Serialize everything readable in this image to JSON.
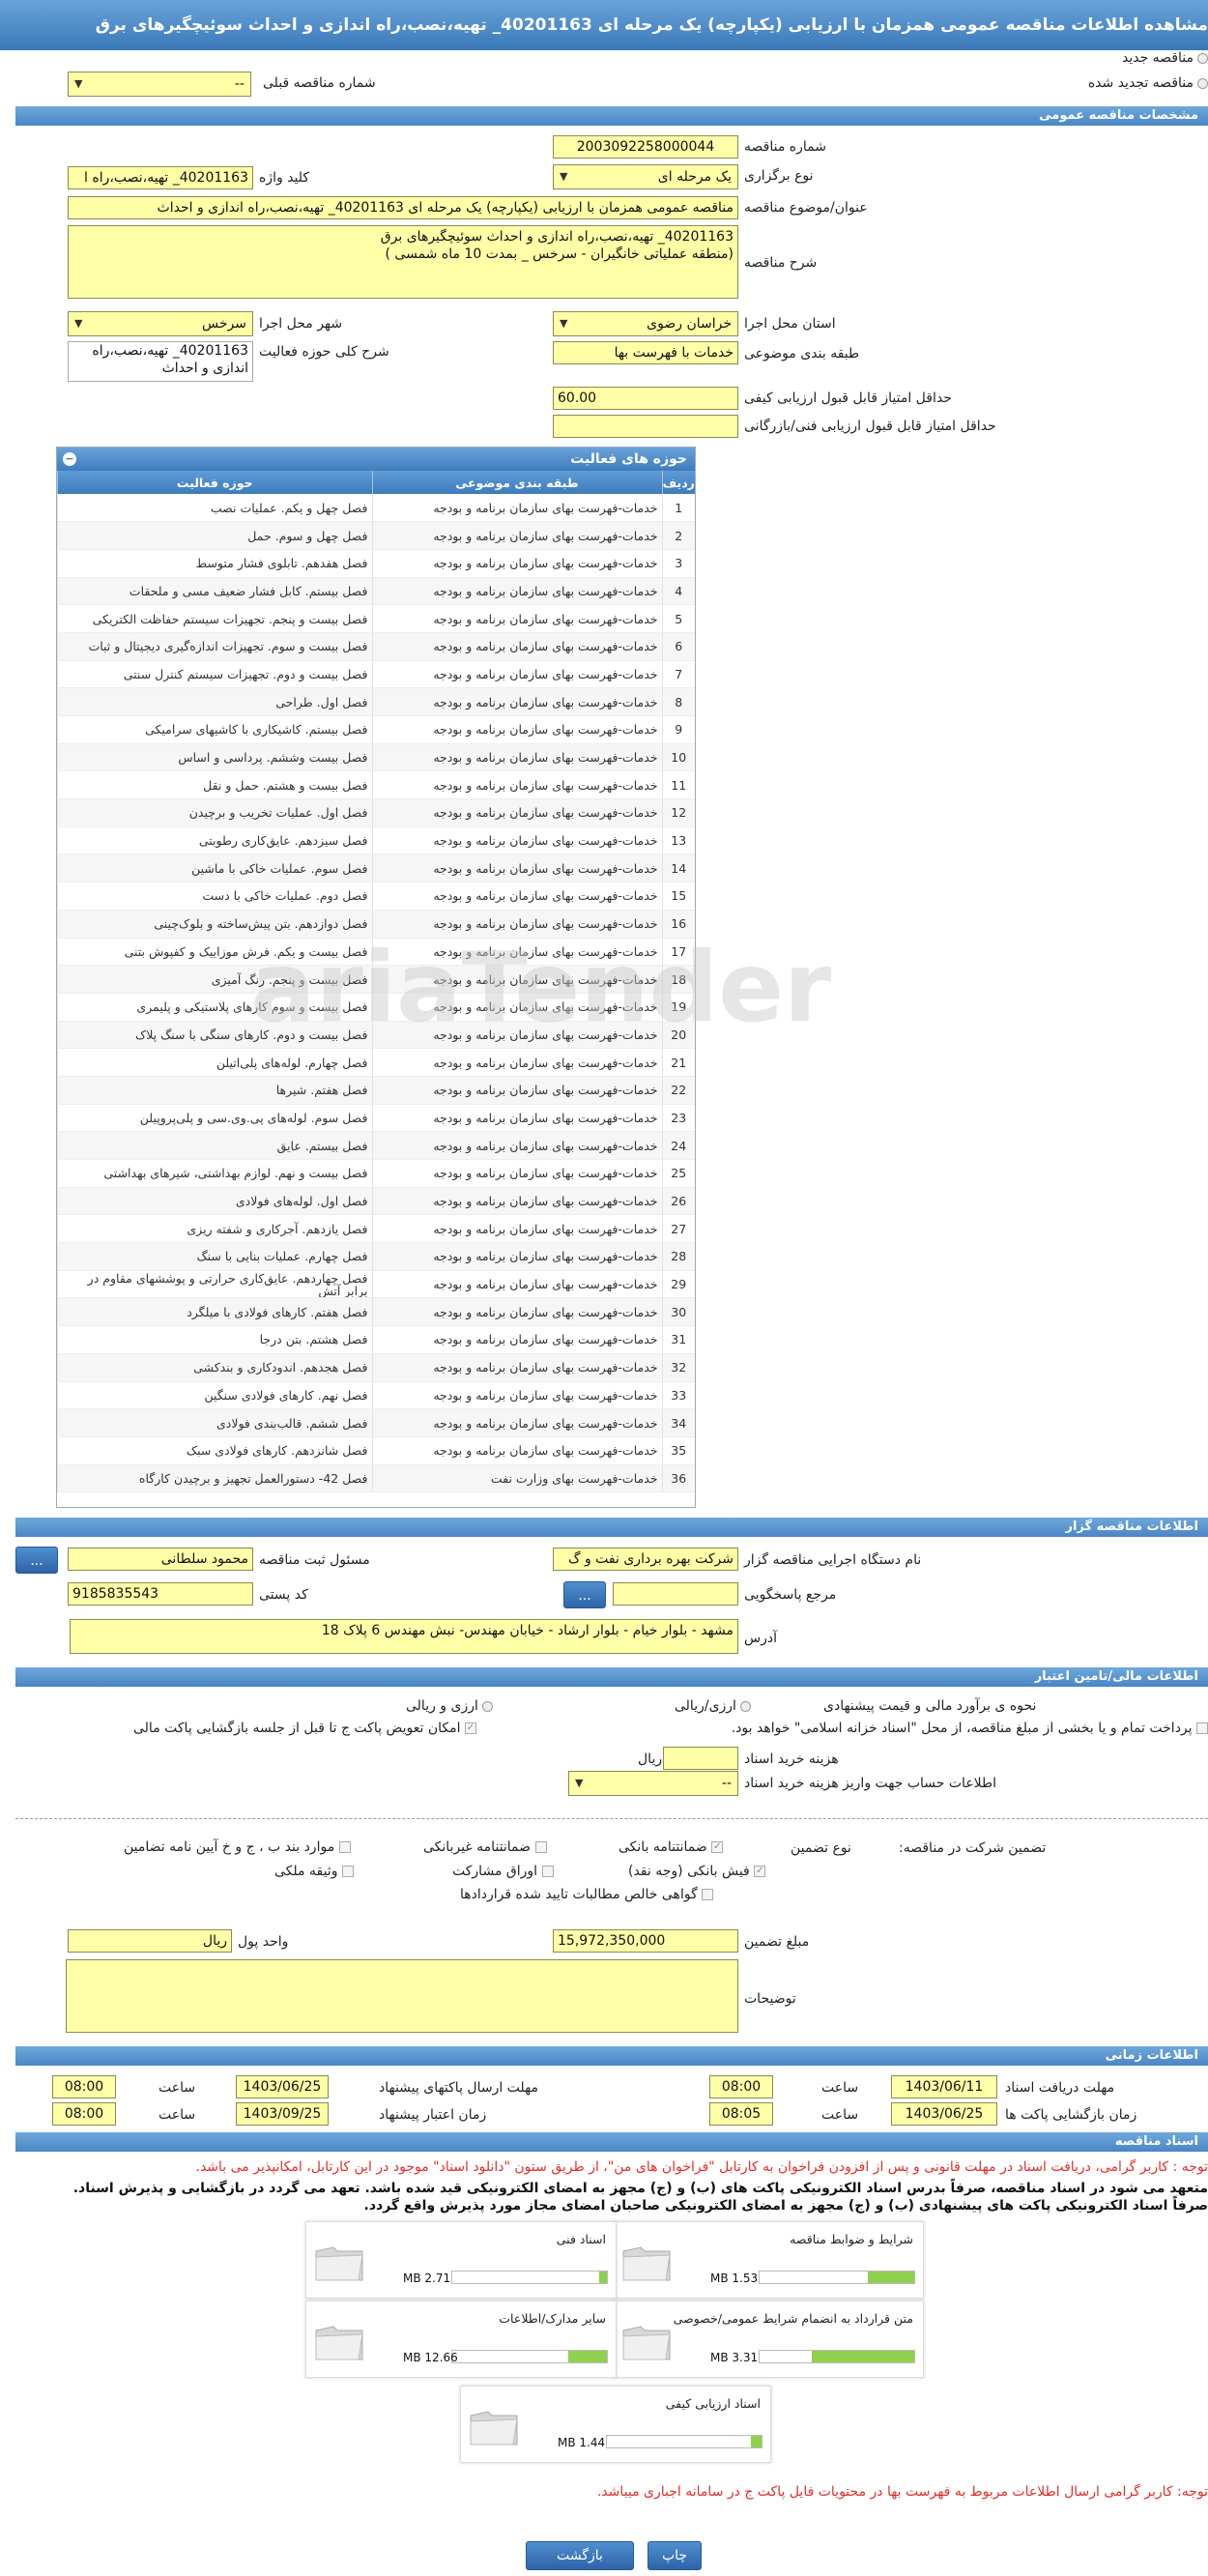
{
  "title": "مشاهده اطلاعات مناقصه عمومی همزمان با ارزیابی (یکپارچه) یک مرحله ای 40201163_ تهیه،نصب،راه اندازی و احداث سوئیچگیرهای برق",
  "top": {
    "new_tender": "مناقصه جدید",
    "renewed_tender": "مناقصه تجدید شده",
    "prev_tender_label": "شماره مناقصه قبلی",
    "prev_tender_value": "--"
  },
  "sections": {
    "general": "مشخصات مناقصه عمومی",
    "organizer": "اطلاعات مناقصه گزار",
    "financial": "اطلاعات مالی/تامین اعتبار",
    "timing": "اطلاعات زمانی",
    "documents": "اسناد مناقصه"
  },
  "general": {
    "number_label": "شماره مناقصه",
    "number": "2003092258000044",
    "method_label": "نوع برگزاری",
    "method": "یک مرحله ای",
    "keyword_label": "کلید واژه",
    "keyword": "40201163_ تهیه،نصب،راه ا",
    "subject_label": "عنوان/موضوع مناقصه",
    "subject": "مناقصه عمومی همزمان با ارزیابی (یکپارچه) یک مرحله ای 40201163_ تهیه،نصب،راه اندازی و احداث",
    "desc_label": "شرح مناقصه",
    "desc_line1": "40201163_ تهیه،نصب،راه اندازی و احداث سوئیچگیرهای برق",
    "desc_line2": "(منطقه عملیاتی خانگیران - سرخس _ بمدت 10 ماه شمسی )",
    "province_label": "استان محل اجرا",
    "province": "خراسان رضوی",
    "city_label": "شهر محل اجرا",
    "city": "سرخس",
    "category_label": "طبقه بندی موضوعی",
    "category": "خدمات با فهرست بها",
    "scope_label": "شرح کلی حوزه فعالیت",
    "scope_line1": "40201163_ تهیه،نصب،راه",
    "scope_line2": "اندازی و احداث",
    "min_quality_label": "حداقل امتیاز قابل قبول ارزیابی کیفی",
    "min_quality": "60.00",
    "min_tech_label": "حداقل امتیاز قابل قبول ارزیابی فنی/بازرگانی",
    "min_tech": ""
  },
  "activities": {
    "title": "حوزه های فعالیت",
    "col_row": "ردیف",
    "col_category": "طبقه بندی موضوعی",
    "col_field": "حوزه فعالیت",
    "rows": [
      {
        "n": "1",
        "c": "خدمات-فهرست بهای سازمان برنامه و بودجه",
        "f": "فصل چهل و یکم. عملیات نصب"
      },
      {
        "n": "2",
        "c": "خدمات-فهرست بهای سازمان برنامه و بودجه",
        "f": "فصل چهل و سوم. حمل"
      },
      {
        "n": "3",
        "c": "خدمات-فهرست بهای سازمان برنامه و بودجه",
        "f": "فصل هفدهم. تابلوی فشار متوسط"
      },
      {
        "n": "4",
        "c": "خدمات-فهرست بهای سازمان برنامه و بودجه",
        "f": "فصل بیستم. کابل فشار ضعیف مسی و ملحقات"
      },
      {
        "n": "5",
        "c": "خدمات-فهرست بهای سازمان برنامه و بودجه",
        "f": "فصل بیست و پنجم. تجهیزات سیستم حفاظت الکتریکی"
      },
      {
        "n": "6",
        "c": "خدمات-فهرست بهای سازمان برنامه و بودجه",
        "f": "فصل بیست و سوم. تجهیزات اندازه‌گیری دیجیتال و ثبات"
      },
      {
        "n": "7",
        "c": "خدمات-فهرست بهای سازمان برنامه و بودجه",
        "f": "فصل بیست و دوم. تجهیزات سیستم کنترل سنتی"
      },
      {
        "n": "8",
        "c": "خدمات-فهرست بهای سازمان برنامه و بودجه",
        "f": "فصل اول. طراحی"
      },
      {
        "n": "9",
        "c": "خدمات-فهرست بهای سازمان برنامه و بودجه",
        "f": "فصل بیستم. کاشیکاری با کاشیهای سرامیکی"
      },
      {
        "n": "10",
        "c": "خدمات-فهرست بهای سازمان برنامه و بودجه",
        "f": "فصل بیست وششم. پرداسی و اساس"
      },
      {
        "n": "11",
        "c": "خدمات-فهرست بهای سازمان برنامه و بودجه",
        "f": "فصل بیست و هشتم. حمل و نقل"
      },
      {
        "n": "12",
        "c": "خدمات-فهرست بهای سازمان برنامه و بودجه",
        "f": "فصل اول. عملیات تخریب و برچیدن"
      },
      {
        "n": "13",
        "c": "خدمات-فهرست بهای سازمان برنامه و بودجه",
        "f": "فصل سیزدهم. عایق‌کاری رطوبتی"
      },
      {
        "n": "14",
        "c": "خدمات-فهرست بهای سازمان برنامه و بودجه",
        "f": "فصل سوم. عملیات خاکی با ماشین"
      },
      {
        "n": "15",
        "c": "خدمات-فهرست بهای سازمان برنامه و بودجه",
        "f": "فصل دوم. عملیات خاکی با دست"
      },
      {
        "n": "16",
        "c": "خدمات-فهرست بهای سازمان برنامه و بودجه",
        "f": "فصل دوازدهم. بتن پیش‌ساخته و بلوک‌چینی"
      },
      {
        "n": "17",
        "c": "خدمات-فهرست بهای سازمان برنامه و بودجه",
        "f": "فصل بیست و یکم. فرش موزاییک و کفپوش بتنی"
      },
      {
        "n": "18",
        "c": "خدمات-فهرست بهای سازمان برنامه و بودجه",
        "f": "فصل بیست و پنجم. رنگ آمیزی"
      },
      {
        "n": "19",
        "c": "خدمات-فهرست بهای سازمان برنامه و بودجه",
        "f": "فصل بیست و سوم کارهای پلاستیکی و پلیمری"
      },
      {
        "n": "20",
        "c": "خدمات-فهرست بهای سازمان برنامه و بودجه",
        "f": "فصل بیست و دوم. کارهای سنگی با سنگ پلاک"
      },
      {
        "n": "21",
        "c": "خدمات-فهرست بهای سازمان برنامه و بودجه",
        "f": "فصل چهارم. لوله‌های پلی‌اتیلن"
      },
      {
        "n": "22",
        "c": "خدمات-فهرست بهای سازمان برنامه و بودجه",
        "f": "فصل هفتم. شیرها"
      },
      {
        "n": "23",
        "c": "خدمات-فهرست بهای سازمان برنامه و بودجه",
        "f": "فصل سوم. لوله‌های پی.وی.سی و پلی‌پروپیلن"
      },
      {
        "n": "24",
        "c": "خدمات-فهرست بهای سازمان برنامه و بودجه",
        "f": "فصل بیستم. عایق"
      },
      {
        "n": "25",
        "c": "خدمات-فهرست بهای سازمان برنامه و بودجه",
        "f": "فصل بیست و نهم. لوازم بهداشتی، شیرهای بهداشتی"
      },
      {
        "n": "26",
        "c": "خدمات-فهرست بهای سازمان برنامه و بودجه",
        "f": "فصل اول. لوله‌های فولادی"
      },
      {
        "n": "27",
        "c": "خدمات-فهرست بهای سازمان برنامه و بودجه",
        "f": "فصل یازدهم. آجرکاری و شفته ریزی"
      },
      {
        "n": "28",
        "c": "خدمات-فهرست بهای سازمان برنامه و بودجه",
        "f": "فصل چهارم. عملیات بنایی با سنگ"
      },
      {
        "n": "29",
        "c": "خدمات-فهرست بهای سازمان برنامه و بودجه",
        "f": "فصل چهاردهم. عایق‌کاری حرارتی و پوششهای مقاوم در برابر آتش"
      },
      {
        "n": "30",
        "c": "خدمات-فهرست بهای سازمان برنامه و بودجه",
        "f": "فصل هفتم. کارهای فولادی با میلگرد"
      },
      {
        "n": "31",
        "c": "خدمات-فهرست بهای سازمان برنامه و بودجه",
        "f": "فصل هشتم. بتن درجا"
      },
      {
        "n": "32",
        "c": "خدمات-فهرست بهای سازمان برنامه و بودجه",
        "f": "فصل هجدهم. اندودکاری و بندکشی"
      },
      {
        "n": "33",
        "c": "خدمات-فهرست بهای سازمان برنامه و بودجه",
        "f": "فصل نهم. کارهای فولادی سنگین"
      },
      {
        "n": "34",
        "c": "خدمات-فهرست بهای سازمان برنامه و بودجه",
        "f": "فصل ششم. قالب‌بندی فولادی"
      },
      {
        "n": "35",
        "c": "خدمات-فهرست بهای سازمان برنامه و بودجه",
        "f": "فصل شانزدهم. کارهای فولادی سبک"
      },
      {
        "n": "36",
        "c": "خدمات-فهرست بهای وزارت نفت",
        "f": "فصل 42- دستورالعمل تجهیز و برچیدن کارگاه"
      }
    ]
  },
  "organizer": {
    "device_label": "نام دستگاه اجرایی مناقصه گزار",
    "device": "شرکت بهره برداری نفت و گ",
    "registrar_label": "مسئول ثبت مناقصه",
    "registrar": "محمود سلطانی",
    "registrar_btn": "...",
    "ref_label": "مرجع پاسخگویی",
    "ref": "",
    "ref_btn": "...",
    "postal_label": "کد پستی",
    "postal": "9185835543",
    "address_label": "آدرس",
    "address": "مشهد - بلوار خیام - بلوار ارشاد - خیابان مهندس- نبش مهندس 6 پلاک 18"
  },
  "financial": {
    "estimate_label": "نحوه ی برآورد مالی و قیمت پیشنهادی",
    "opt_rial_fx": "ارزی/ریالی",
    "opt_fx_rial": "ارزی و ریالی",
    "swap_label": "امکان تعویض پاکت ج تا قبل از جلسه بازگشایی پاکت مالی",
    "payment_label": "پرداخت تمام و یا بخشی از مبلغ مناقصه، از محل \"اسناد خزانه اسلامی\" خواهد بود.",
    "doc_fee_label": "هزینه خرید اسناد",
    "doc_fee": "",
    "doc_fee_unit": "ریال",
    "account_label": "اطلاعات حساب جهت واریز هزینه خرید اسناد",
    "account": "--",
    "guarantee_label": "تضمین شرکت در مناقصه:",
    "guarantee_type_label": "نوع تضمین",
    "g_bank": "ضمانتنامه بانکی",
    "g_nonbank": "ضمانتنامه غیربانکی",
    "g_clauses": "موارد بند ب ، ج و خ آیین نامه تضامین",
    "g_cheque": "فیش بانکی (وجه نقد)",
    "g_bonds": "اوراق مشارکت",
    "g_property": "وثیقه ملکی",
    "g_claims": "گواهی خالص مطالبات تایید شده قراردادها",
    "amount_label": "مبلغ تضمین",
    "amount": "15,972,350,000",
    "currency_label": "واحد پول",
    "currency": "ریال",
    "notes_label": "توضیحات",
    "notes": ""
  },
  "timing": {
    "doc_receive_label": "مهلت دریافت اسناد",
    "doc_receive_date": "1403/06/11",
    "doc_receive_time": "08:00",
    "submit_label": "مهلت ارسال پاکتهای پیشنهاد",
    "submit_date": "1403/06/25",
    "submit_time": "08:00",
    "open_label": "زمان بازگشایی پاکت ها",
    "open_date": "1403/06/25",
    "open_time": "08:05",
    "validity_label": "زمان اعتبار پیشنهاد",
    "validity_date": "1403/09/25",
    "validity_time": "08:00",
    "time_label": "ساعت"
  },
  "documents": {
    "note1": "توجه : کاربر گرامی، دریافت اسناد در مهلت قانونی و پس از افزودن فراخوان به کارتابل \"فراخوان های من\"، از طریق ستون \"دانلود اسناد\" موجود در این کارتابل، امکانپذیر می باشد.",
    "note2": "متعهد می شود در اسناد مناقصه، صرفاً بدرس اسناد الکترونیکی پاکت های (ب) و (ج) مجهز به امضای الکترونیکی قید شده باشد. تعهد می گردد در بازگشایی و پذیرش اسناد.",
    "note3": "صرفاً اسناد الکترونیکی پاکت های پیشنهادی (ب) و (ج) مجهز به امضای الکترونیکی صاحبان امضای مجاز مورد پذیرش واقع گردد.",
    "files": [
      {
        "title": "شرایط و ضوابط مناقصه",
        "size": "1.53 MB",
        "max": "5 MB",
        "pct": 0.3
      },
      {
        "title": "اسناد فنی",
        "size": "2.71 MB",
        "max": "50 MB",
        "pct": 0.05
      },
      {
        "title": "متن قرارداد به انضمام شرایط عمومی/خصوصی",
        "size": "3.31 MB",
        "max": "5 MB",
        "pct": 0.66
      },
      {
        "title": "سایر مدارک/اطلاعات",
        "size": "12.66 MB",
        "max": "50 MB",
        "pct": 0.25
      },
      {
        "title": "اسناد ارزیابی کیفی",
        "size": "1.44 MB",
        "max": "20 MB",
        "pct": 0.07
      }
    ],
    "note4": "توجه: کاربر گرامی ارسال اطلاعات مربوط به فهرست بها در محتویات فایل پاکت ج در سامانه اجباری میباشد."
  },
  "buttons": {
    "back": "بازگشت",
    "print": "چاپ"
  },
  "colors": {
    "accent": "#3e7cbc",
    "field": "#ffffa8",
    "danger": "#e0302a",
    "progress": "#8fd14f"
  }
}
